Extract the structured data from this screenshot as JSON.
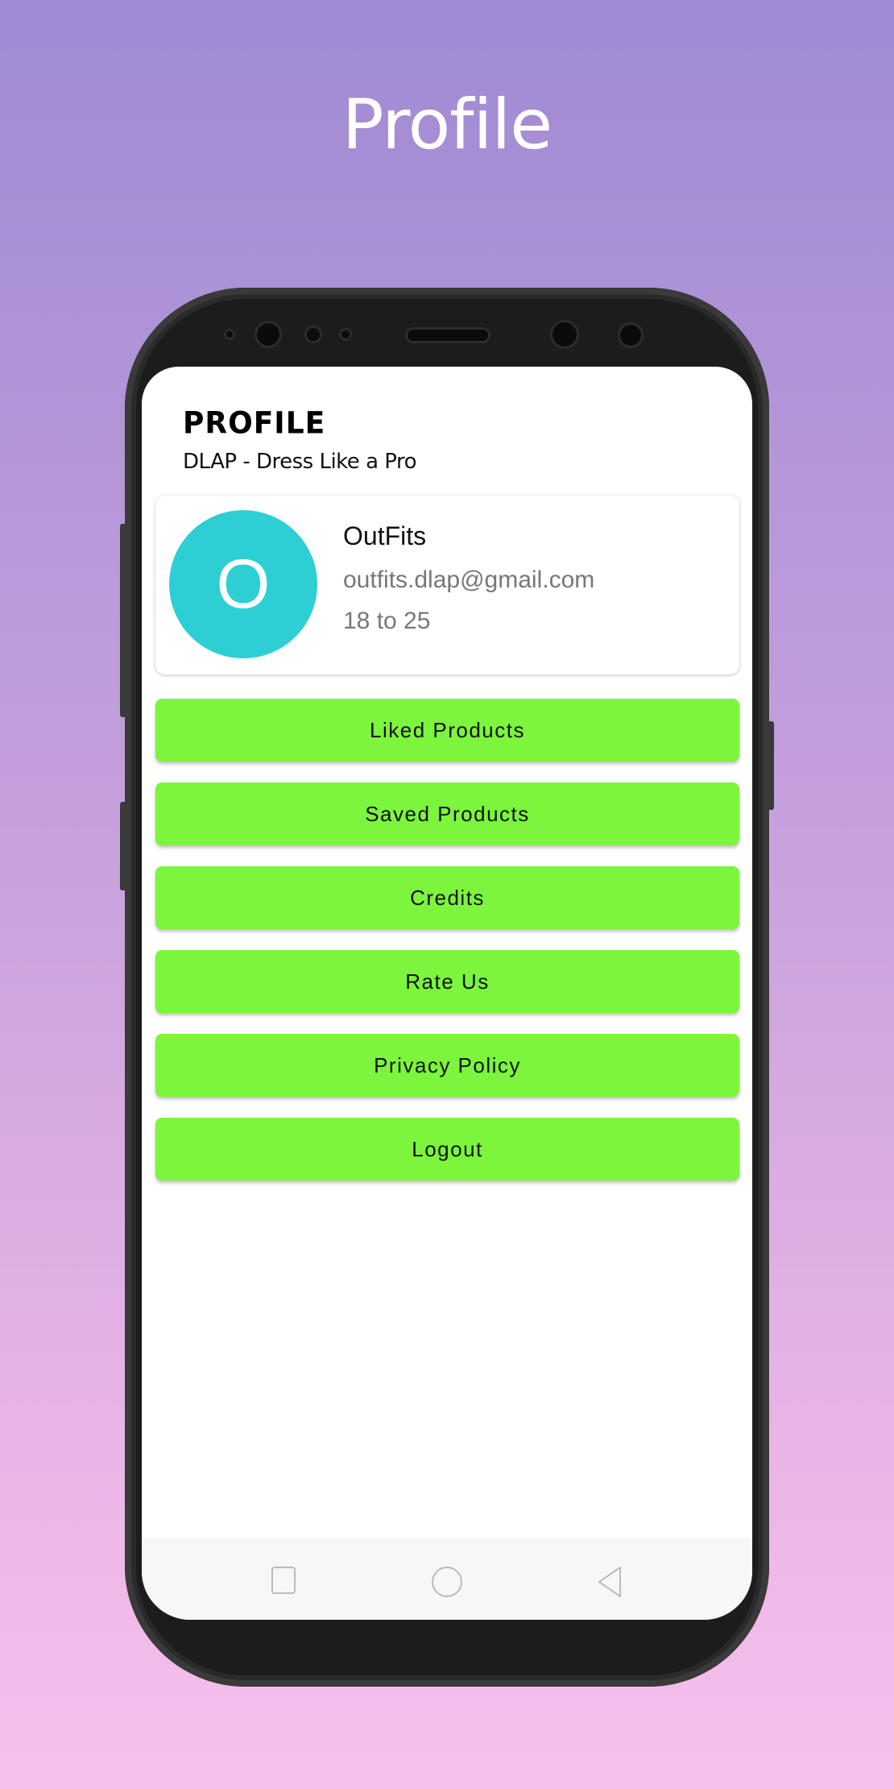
{
  "page_title": "Profile",
  "app": {
    "header_title": "PROFILE",
    "header_subtitle": "DLAP - Dress Like a Pro"
  },
  "profile": {
    "avatar_initial": "O",
    "avatar_color": "#2ecfd4",
    "name": "OutFits",
    "email": "outfits.dlap@gmail.com",
    "age_range": "18 to 25"
  },
  "menu": {
    "button_color": "#7cf53c",
    "items": [
      {
        "label": "Liked Products"
      },
      {
        "label": "Saved Products"
      },
      {
        "label": "Credits"
      },
      {
        "label": "Rate Us"
      },
      {
        "label": "Privacy Policy"
      },
      {
        "label": "Logout"
      }
    ]
  },
  "system_nav": {
    "icons": [
      "recents-icon",
      "home-icon",
      "back-icon"
    ]
  }
}
